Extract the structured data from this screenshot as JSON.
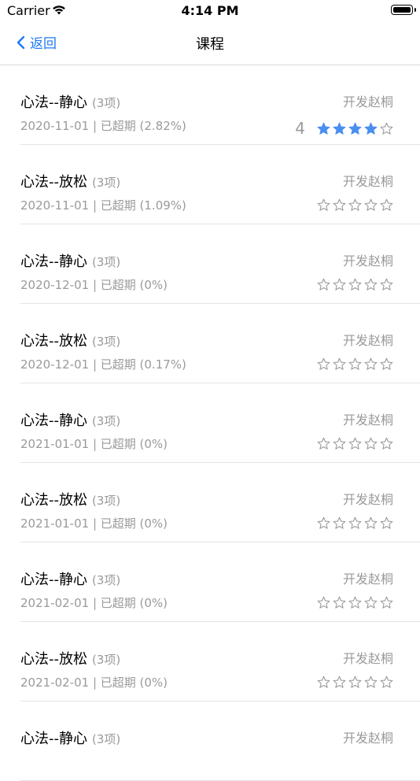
{
  "status_bar": {
    "carrier": "Carrier",
    "time": "4:14 PM"
  },
  "nav": {
    "back_label": "返回",
    "title": "课程"
  },
  "courses": [
    {
      "title": "心法--静心",
      "count": "(3项)",
      "meta": "2020-11-01 | 已超期 (2.82%)",
      "teacher": "开发赵桐",
      "rating": "4",
      "stars": 4
    },
    {
      "title": "心法--放松",
      "count": "(3项)",
      "meta": "2020-11-01 | 已超期 (1.09%)",
      "teacher": "开发赵桐",
      "rating": "",
      "stars": 0
    },
    {
      "title": "心法--静心",
      "count": "(3项)",
      "meta": "2020-12-01 | 已超期 (0%)",
      "teacher": "开发赵桐",
      "rating": "",
      "stars": 0
    },
    {
      "title": "心法--放松",
      "count": "(3项)",
      "meta": "2020-12-01 | 已超期 (0.17%)",
      "teacher": "开发赵桐",
      "rating": "",
      "stars": 0
    },
    {
      "title": "心法--静心",
      "count": "(3项)",
      "meta": "2021-01-01 | 已超期 (0%)",
      "teacher": "开发赵桐",
      "rating": "",
      "stars": 0
    },
    {
      "title": "心法--放松",
      "count": "(3项)",
      "meta": "2021-01-01 | 已超期 (0%)",
      "teacher": "开发赵桐",
      "rating": "",
      "stars": 0
    },
    {
      "title": "心法--静心",
      "count": "(3项)",
      "meta": "2021-02-01 | 已超期 (0%)",
      "teacher": "开发赵桐",
      "rating": "",
      "stars": 0
    },
    {
      "title": "心法--放松",
      "count": "(3项)",
      "meta": "2021-02-01 | 已超期 (0%)",
      "teacher": "开发赵桐",
      "rating": "",
      "stars": 0
    },
    {
      "title": "心法--静心",
      "count": "(3项)",
      "meta": "",
      "teacher": "开发赵桐",
      "rating": "",
      "stars": 0
    }
  ],
  "colors": {
    "accent": "#1f7af5",
    "star_filled": "#4a8ff0",
    "star_empty": "#9a9a9a",
    "secondary_text": "#9a9a9a"
  }
}
